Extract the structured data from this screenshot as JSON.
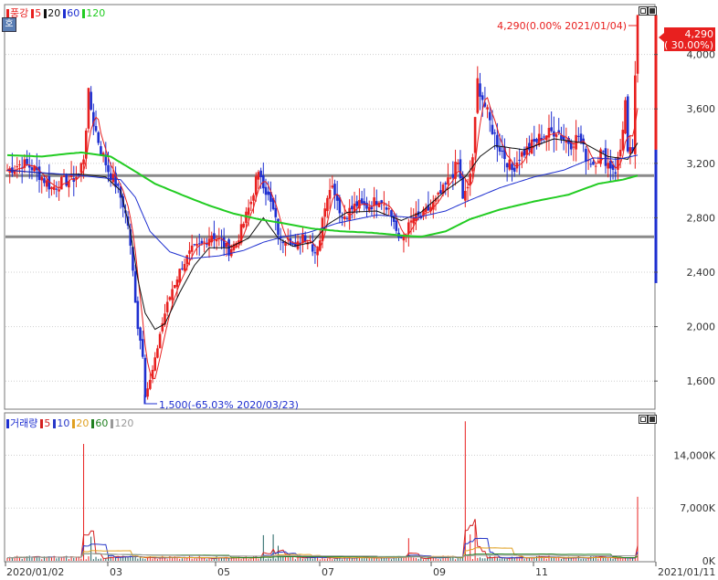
{
  "colors": {
    "up": "#e8201f",
    "down": "#1e2fd0",
    "ma5": "#e8201f",
    "ma20": "#111111",
    "ma60": "#1e2fd0",
    "ma120": "#22cc22",
    "vol5": "#d42020",
    "vol10": "#2838c8",
    "vol20": "#e0a020",
    "vol60": "#208020",
    "vol120": "#999999",
    "hline": "#8a8a8a",
    "grid": "#cfcfcf"
  },
  "price_panel": {
    "legend": [
      {
        "text": "풍강",
        "color": "#e8201f"
      },
      {
        "text": "5",
        "color": "#e8201f"
      },
      {
        "text": "20",
        "color": "#111111"
      },
      {
        "text": "60",
        "color": "#1e2fd0"
      },
      {
        "text": "120",
        "color": "#22cc22"
      }
    ],
    "corner_glyph": "호",
    "last_label": "4,290",
    "last_pct": "( 30.00%)",
    "high_annotation": "4,290(0.00% 2021/01/04)",
    "low_annotation": "1,500(-65.03% 2020/03/23)"
  },
  "volume_panel": {
    "legend": [
      {
        "text": "거래량",
        "color": "#1e2fd0"
      },
      {
        "text": "5",
        "color": "#d42020"
      },
      {
        "text": "10",
        "color": "#2838c8"
      },
      {
        "text": "20",
        "color": "#e0a020"
      },
      {
        "text": "60",
        "color": "#208020"
      },
      {
        "text": "120",
        "color": "#999999"
      }
    ]
  },
  "chart_data": {
    "type": "candlestick",
    "price_axis": {
      "ticks": [
        "4,000",
        "3,600",
        "3,200",
        "2,800",
        "2,400",
        "2,000",
        "1,600"
      ],
      "values": [
        4000,
        3600,
        3200,
        2800,
        2400,
        2000,
        1600
      ],
      "range": [
        1400,
        4360
      ]
    },
    "volume_axis": {
      "ticks": [
        "14,000K",
        "7,000K",
        "0K"
      ],
      "values": [
        14000,
        7000,
        0
      ],
      "range": [
        0,
        19500
      ]
    },
    "x_ticks": [
      "2020/01/02",
      "03",
      "05",
      "07",
      "09",
      "11",
      "2021/01/11"
    ],
    "horizontal_lines": [
      3110,
      2660
    ],
    "price_anchors": [
      [
        0,
        3150
      ],
      [
        6,
        3200
      ],
      [
        10,
        3170
      ],
      [
        14,
        3100
      ],
      [
        18,
        3020
      ],
      [
        22,
        3060
      ],
      [
        26,
        3080
      ],
      [
        29,
        3120
      ],
      [
        31,
        3250
      ],
      [
        33,
        3700
      ],
      [
        35,
        3500
      ],
      [
        38,
        3300
      ],
      [
        41,
        3150
      ],
      [
        44,
        3050
      ],
      [
        47,
        2900
      ],
      [
        49,
        2750
      ],
      [
        51,
        2400
      ],
      [
        53,
        2000
      ],
      [
        55,
        1800
      ],
      [
        56,
        1500
      ],
      [
        58,
        1600
      ],
      [
        60,
        1750
      ],
      [
        62,
        1950
      ],
      [
        64,
        2100
      ],
      [
        67,
        2280
      ],
      [
        71,
        2450
      ],
      [
        75,
        2560
      ],
      [
        79,
        2600
      ],
      [
        83,
        2680
      ],
      [
        87,
        2620
      ],
      [
        90,
        2560
      ],
      [
        93,
        2620
      ],
      [
        96,
        2760
      ],
      [
        99,
        2920
      ],
      [
        101,
        3080
      ],
      [
        103,
        3120
      ],
      [
        105,
        3000
      ],
      [
        108,
        2850
      ],
      [
        111,
        2620
      ],
      [
        114,
        2680
      ],
      [
        117,
        2560
      ],
      [
        120,
        2680
      ],
      [
        123,
        2620
      ],
      [
        125,
        2550
      ],
      [
        127,
        2650
      ],
      [
        129,
        2900
      ],
      [
        131,
        3050
      ],
      [
        133,
        3000
      ],
      [
        136,
        2800
      ],
      [
        139,
        2850
      ],
      [
        142,
        2900
      ],
      [
        145,
        2880
      ],
      [
        148,
        2900
      ],
      [
        151,
        2950
      ],
      [
        154,
        2900
      ],
      [
        157,
        2780
      ],
      [
        159,
        2620
      ],
      [
        162,
        2700
      ],
      [
        165,
        2800
      ],
      [
        168,
        2800
      ],
      [
        171,
        2860
      ],
      [
        174,
        2920
      ],
      [
        177,
        3000
      ],
      [
        180,
        3100
      ],
      [
        183,
        3200
      ],
      [
        185,
        2950
      ],
      [
        187,
        3000
      ],
      [
        189,
        3250
      ],
      [
        190,
        3500
      ],
      [
        191,
        3800
      ],
      [
        193,
        3680
      ],
      [
        196,
        3500
      ],
      [
        199,
        3350
      ],
      [
        202,
        3250
      ],
      [
        205,
        3150
      ],
      [
        208,
        3250
      ],
      [
        211,
        3300
      ],
      [
        214,
        3350
      ],
      [
        217,
        3400
      ],
      [
        220,
        3420
      ],
      [
        223,
        3450
      ],
      [
        226,
        3380
      ],
      [
        229,
        3350
      ],
      [
        232,
        3400
      ],
      [
        235,
        3250
      ],
      [
        238,
        3200
      ],
      [
        241,
        3280
      ],
      [
        244,
        3200
      ],
      [
        247,
        3150
      ],
      [
        249,
        3300
      ],
      [
        251,
        3650
      ],
      [
        252,
        3250
      ],
      [
        254,
        3300
      ],
      [
        256,
        4290
      ]
    ],
    "ma_anchors": {
      "ma20": [
        [
          0,
          3150
        ],
        [
          20,
          3120
        ],
        [
          30,
          3120
        ],
        [
          40,
          3100
        ],
        [
          46,
          3000
        ],
        [
          50,
          2700
        ],
        [
          53,
          2350
        ],
        [
          56,
          2100
        ],
        [
          60,
          1980
        ],
        [
          64,
          2020
        ],
        [
          70,
          2250
        ],
        [
          76,
          2450
        ],
        [
          82,
          2580
        ],
        [
          90,
          2580
        ],
        [
          98,
          2650
        ],
        [
          104,
          2800
        ],
        [
          110,
          2650
        ],
        [
          116,
          2590
        ],
        [
          124,
          2620
        ],
        [
          130,
          2750
        ],
        [
          138,
          2840
        ],
        [
          150,
          2850
        ],
        [
          160,
          2780
        ],
        [
          168,
          2840
        ],
        [
          178,
          3000
        ],
        [
          186,
          3100
        ],
        [
          192,
          3250
        ],
        [
          198,
          3330
        ],
        [
          210,
          3300
        ],
        [
          222,
          3380
        ],
        [
          234,
          3350
        ],
        [
          244,
          3250
        ],
        [
          252,
          3230
        ],
        [
          256,
          3350
        ]
      ],
      "ma60": [
        [
          0,
          3150
        ],
        [
          30,
          3110
        ],
        [
          46,
          3080
        ],
        [
          52,
          2950
        ],
        [
          58,
          2700
        ],
        [
          66,
          2550
        ],
        [
          74,
          2500
        ],
        [
          86,
          2520
        ],
        [
          96,
          2560
        ],
        [
          104,
          2620
        ],
        [
          112,
          2660
        ],
        [
          122,
          2690
        ],
        [
          134,
          2760
        ],
        [
          150,
          2820
        ],
        [
          166,
          2800
        ],
        [
          178,
          2850
        ],
        [
          188,
          2930
        ],
        [
          200,
          3020
        ],
        [
          214,
          3100
        ],
        [
          226,
          3150
        ],
        [
          238,
          3240
        ],
        [
          248,
          3230
        ],
        [
          256,
          3260
        ]
      ],
      "ma120": [
        [
          0,
          3260
        ],
        [
          14,
          3250
        ],
        [
          24,
          3270
        ],
        [
          30,
          3280
        ],
        [
          42,
          3250
        ],
        [
          52,
          3140
        ],
        [
          60,
          3050
        ],
        [
          72,
          2960
        ],
        [
          82,
          2890
        ],
        [
          92,
          2830
        ],
        [
          102,
          2790
        ],
        [
          112,
          2760
        ],
        [
          124,
          2720
        ],
        [
          136,
          2700
        ],
        [
          148,
          2690
        ],
        [
          160,
          2670
        ],
        [
          168,
          2660
        ],
        [
          178,
          2700
        ],
        [
          188,
          2790
        ],
        [
          200,
          2860
        ],
        [
          214,
          2920
        ],
        [
          228,
          2970
        ],
        [
          240,
          3050
        ],
        [
          250,
          3080
        ],
        [
          256,
          3110
        ]
      ]
    },
    "volume_spikes": [
      [
        31,
        15500
      ],
      [
        34,
        3200
      ],
      [
        104,
        3400
      ],
      [
        108,
        3500
      ],
      [
        110,
        2000
      ],
      [
        163,
        3000
      ],
      [
        186,
        18500
      ],
      [
        188,
        3500
      ],
      [
        190,
        4800
      ],
      [
        256,
        8500
      ]
    ],
    "last_close": 4290,
    "last_change_pct": 30.0,
    "period_high": 4290,
    "period_high_date": "2021/01/04",
    "period_low": 1500,
    "period_low_pct": -65.03,
    "period_low_date": "2020/03/23",
    "legend_entries": [
      "풍강",
      "5",
      "20",
      "60",
      "120",
      "거래량",
      "5",
      "10",
      "20",
      "60",
      "120"
    ]
  }
}
